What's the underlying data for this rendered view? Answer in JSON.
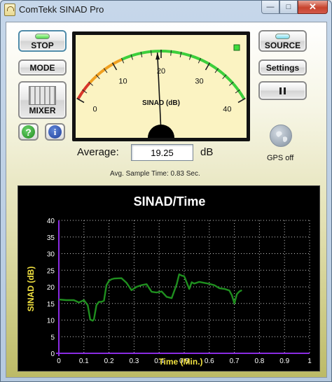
{
  "window": {
    "title": "ComTekk SINAD Pro",
    "minimize_label": "—",
    "maximize_label": "□",
    "close_label": "✕"
  },
  "controls": {
    "stop_label": "STOP",
    "mode_label": "MODE",
    "mixer_label": "MIXER",
    "source_label": "SOURCE",
    "settings_label": "Settings",
    "help_label": "?",
    "info_label": "i"
  },
  "meter": {
    "label": "SINAD (dB)",
    "scale_min": 0,
    "scale_max": 40,
    "tick_labels": [
      "0",
      "10",
      "20",
      "30",
      "40"
    ],
    "reading": 19.25,
    "status_indicator_color": "#3ddc3d"
  },
  "gps": {
    "label": "GPS off",
    "icon": "globe-icon"
  },
  "average": {
    "label": "Average:",
    "value": "19.25",
    "unit": "dB"
  },
  "sample_time": "Avg. Sample Time: 0.83 Sec.",
  "colors": {
    "plot_line": "#1f8f1f",
    "axis": "#8a2be2",
    "grid": "#c8c8c8",
    "axis_labels": "#f0e040"
  },
  "chart_data": {
    "type": "line",
    "title": "SINAD/Time",
    "xlabel": "Time (Min.)",
    "ylabel": "SINAD (dB)",
    "xlim": [
      0,
      1
    ],
    "ylim": [
      0,
      40
    ],
    "x_ticks": [
      "0",
      "0.1",
      "0.2",
      "0.3",
      "0.4",
      "0.5",
      "0.6",
      "0.7",
      "0.8",
      "0.9",
      "1"
    ],
    "y_ticks": [
      "0",
      "5",
      "10",
      "15",
      "20",
      "25",
      "30",
      "35",
      "40"
    ],
    "grid": true,
    "series": [
      {
        "x": [
          0.0,
          0.03,
          0.06,
          0.08,
          0.1,
          0.115,
          0.125,
          0.135,
          0.14,
          0.15,
          0.16,
          0.17,
          0.18,
          0.19,
          0.2,
          0.21,
          0.22,
          0.25,
          0.27,
          0.29,
          0.31,
          0.33,
          0.35,
          0.37,
          0.39,
          0.41,
          0.43,
          0.45,
          0.47,
          0.48,
          0.49,
          0.5,
          0.52,
          0.53,
          0.54,
          0.56,
          0.58,
          0.6,
          0.62,
          0.64,
          0.66,
          0.68,
          0.69,
          0.7,
          0.71,
          0.72,
          0.73
        ],
        "y": [
          16.2,
          16.0,
          16.0,
          15.3,
          16.0,
          14.5,
          10.2,
          9.8,
          10.2,
          14.5,
          15.5,
          15.5,
          15.8,
          20.5,
          21.8,
          22.3,
          22.5,
          22.6,
          21.2,
          19.0,
          20.0,
          20.5,
          20.8,
          18.5,
          18.3,
          18.6,
          17.0,
          16.6,
          20.8,
          23.8,
          23.4,
          23.2,
          19.4,
          21.4,
          21.0,
          21.5,
          21.2,
          20.9,
          20.5,
          19.6,
          19.4,
          18.9,
          17.5,
          15.0,
          17.8,
          18.6,
          19.0
        ]
      }
    ]
  }
}
